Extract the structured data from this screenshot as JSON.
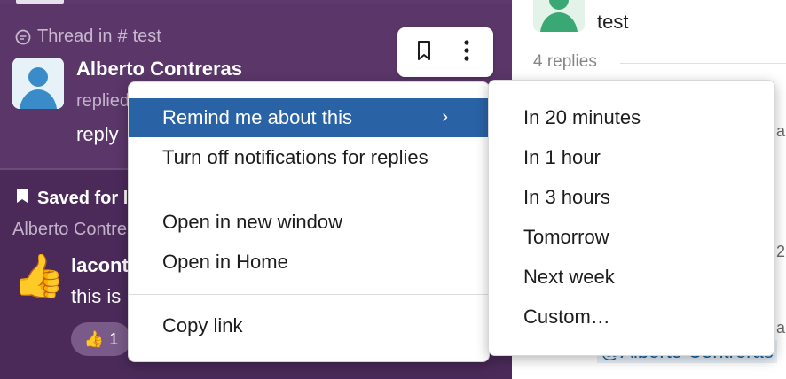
{
  "thread": {
    "header": "Thread in",
    "channel": "test",
    "author": "Alberto Contreras",
    "sub": "replied",
    "text": "reply"
  },
  "saved": {
    "header": "Saved for la",
    "sub": "Alberto Contre",
    "author": "lacont",
    "text": "this is",
    "reaction_count": "1"
  },
  "right": {
    "title": "test",
    "replies": "4 replies",
    "mention": "@Alberto Contreras",
    "peek_a": "a",
    "peek_2": "2"
  },
  "menu": {
    "items": [
      {
        "label": "Remind me about this",
        "chevron": "›"
      },
      {
        "label": "Turn off notifications for replies"
      },
      {
        "label": "Open in new window"
      },
      {
        "label": "Open in Home"
      },
      {
        "label": "Copy link"
      }
    ]
  },
  "submenu": {
    "items": [
      {
        "label": "In 20 minutes"
      },
      {
        "label": "In 1 hour"
      },
      {
        "label": "In 3 hours"
      },
      {
        "label": "Tomorrow"
      },
      {
        "label": "Next week"
      },
      {
        "label": "Custom…"
      }
    ]
  },
  "colors": {
    "sidebar_bg": "#4b2a5a",
    "thread_bg": "#5a3669",
    "menu_highlight": "#2a62a6"
  },
  "icons": {
    "thread": "thread-icon",
    "bookmark": "bookmark-icon",
    "more": "more-vertical-icon",
    "saved": "bookmark-filled-icon",
    "thumbs_up": "thumbs-up-icon"
  }
}
